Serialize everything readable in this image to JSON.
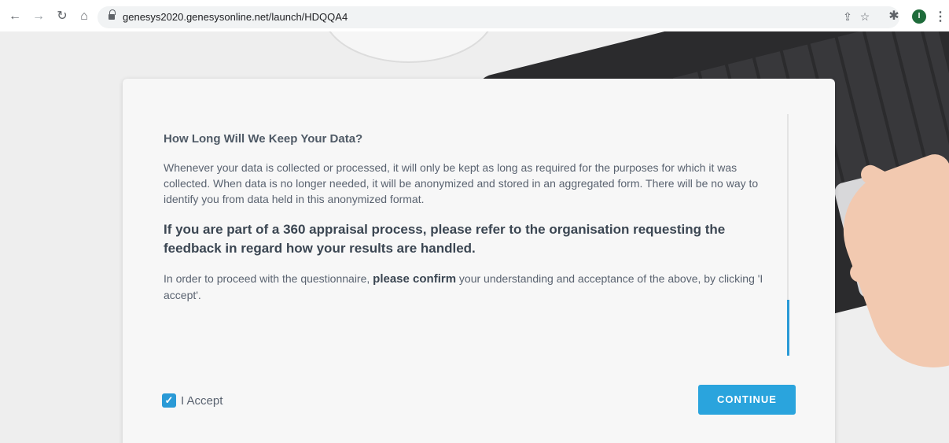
{
  "browser": {
    "url": "genesys2020.genesysonline.net/launch/HDQQA4",
    "avatar_initial": "I",
    "icons": [
      "back-arrow-icon",
      "forward-arrow-icon",
      "reload-icon",
      "home-icon",
      "lock-icon",
      "share-icon",
      "star-icon",
      "puzzle-icon",
      "kebab-menu-icon"
    ]
  },
  "modal": {
    "heading": "How Long Will We Keep Your Data?",
    "paragraph1": "Whenever your data is collected or processed, it will only be kept as long as required for the purposes for which it was collected. When data is no longer needed, it will be anonymized and stored in an aggregated form. There will be no way to identify you from data held in this anonymized format.",
    "bold_paragraph": "If you are part of a 360 appraisal process, please refer to the organisation requesting the feedback in regard how your results are handled.",
    "confirm_prefix": "In order to proceed with the questionnaire, ",
    "confirm_emphasis": "please confirm",
    "confirm_suffix": " your understanding and acceptance of the above, by clicking 'I accept'.",
    "accept_label": "I Accept",
    "accept_checked": true,
    "continue_label": "CONTINUE"
  },
  "colors": {
    "accent": "#2aa4dd",
    "text": "#5a6370",
    "card_bg": "#f7f7f7"
  }
}
